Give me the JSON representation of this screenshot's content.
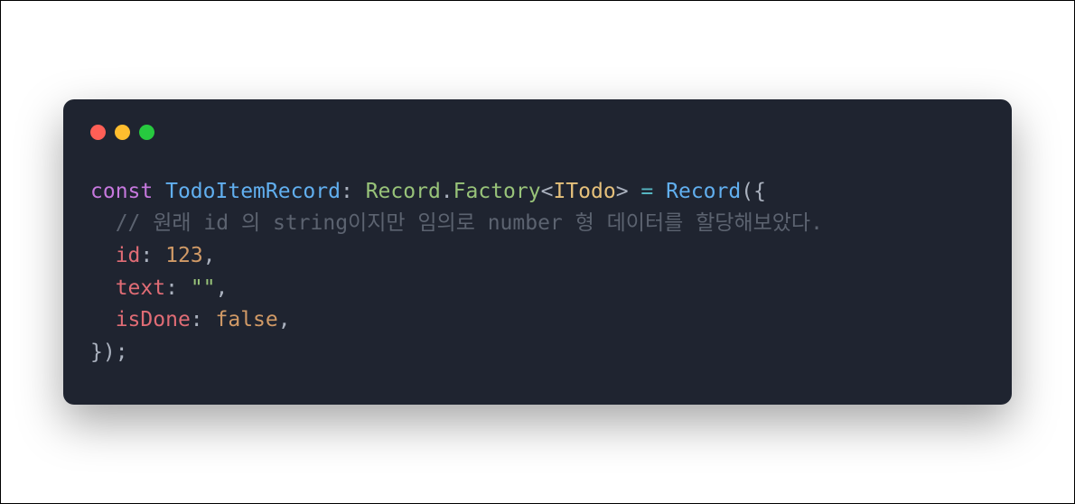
{
  "window": {
    "traffic_lights": [
      "red",
      "yellow",
      "green"
    ]
  },
  "code": {
    "line1": {
      "kw_const": "const",
      "var_name": "TodoItemRecord",
      "colon1": ":",
      "type_ns": "Record",
      "dot": ".",
      "type_member": "Factory",
      "lt": "<",
      "generic": "ITodo",
      "gt": ">",
      "eq": "=",
      "func_call": "Record",
      "open": "({"
    },
    "line2": {
      "indent": "  ",
      "comment": "// 원래 id 의 string이지만 임의로 number 형 데이터를 할당해보았다."
    },
    "line3": {
      "indent": "  ",
      "prop": "id",
      "colon": ":",
      "value": "123",
      "comma": ","
    },
    "line4": {
      "indent": "  ",
      "prop": "text",
      "colon": ":",
      "value": "\"\"",
      "comma": ","
    },
    "line5": {
      "indent": "  ",
      "prop": "isDone",
      "colon": ":",
      "value": "false",
      "comma": ","
    },
    "line6": {
      "close": "});"
    }
  }
}
